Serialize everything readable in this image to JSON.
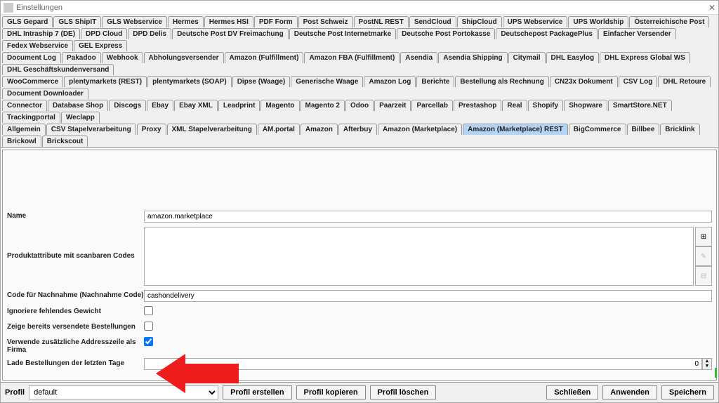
{
  "title": "Einstellungen",
  "tabs_row1": [
    "GLS Gepard",
    "GLS ShipIT",
    "GLS Webservice",
    "Hermes",
    "Hermes HSI",
    "PDF Form",
    "Post Schweiz",
    "PostNL REST",
    "SendCloud",
    "ShipCloud",
    "UPS Webservice",
    "UPS Worldship",
    "Österreichische Post"
  ],
  "tabs_row2": [
    "DHL Intraship 7 (DE)",
    "DPD Cloud",
    "DPD Delis",
    "Deutsche Post DV Freimachung",
    "Deutsche Post Internetmarke",
    "Deutsche Post Portokasse",
    "Deutschepost PackagePlus",
    "Einfacher Versender",
    "Fedex Webservice",
    "GEL Express"
  ],
  "tabs_row3": [
    "Document Log",
    "Pakadoo",
    "Webhook",
    "Abholungsversender",
    "Amazon (Fulfillment)",
    "Amazon FBA (Fulfillment)",
    "Asendia",
    "Asendia Shipping",
    "Citymail",
    "DHL Easylog",
    "DHL Express Global WS",
    "DHL Geschäftskundenversand"
  ],
  "tabs_row4": [
    "WooCommerce",
    "plentymarkets (REST)",
    "plentymarkets (SOAP)",
    "Dipse (Waage)",
    "Generische Waage",
    "Amazon Log",
    "Berichte",
    "Bestellung als Rechnung",
    "CN23x Dokument",
    "CSV Log",
    "DHL Retoure",
    "Document Downloader"
  ],
  "tabs_row5": [
    "Connector",
    "Database Shop",
    "Discogs",
    "Ebay",
    "Ebay XML",
    "Leadprint",
    "Magento",
    "Magento 2",
    "Odoo",
    "Paarzeit",
    "Parcellab",
    "Prestashop",
    "Real",
    "Shopify",
    "Shopware",
    "SmartStore.NET",
    "Trackingportal",
    "Weclapp"
  ],
  "tabs_row6": [
    "Allgemein",
    "CSV Stapelverarbeitung",
    "Proxy",
    "XML Stapelverarbeitung",
    "AM.portal",
    "Amazon",
    "Afterbuy",
    "Amazon (Marketplace)",
    "Amazon (Marketplace) REST",
    "BigCommerce",
    "Billbee",
    "Bricklink",
    "Brickowl",
    "Brickscout"
  ],
  "active_tab": "Amazon (Marketplace) REST",
  "form": {
    "name_label": "Name",
    "name_value": "amazon.marketplace",
    "attrs_label": "Produktattribute mit scanbaren Codes",
    "attrs_value": "",
    "code_label": "Code für Nachnahme (Nachnahme Code)",
    "code_value": "cashondelivery",
    "ignore_label": "Ignoriere fehlendes Gewicht",
    "ignore_value": false,
    "show_sent_label": "Zeige bereits versendete Bestellungen",
    "show_sent_value": false,
    "extra_addr_label": "Verwende zusätzliche Addresszeile als Firma",
    "extra_addr_value": true,
    "load_days_label": "Lade Bestellungen der letzten Tage",
    "load_days_value": "0"
  },
  "icons": {
    "add": "⊞",
    "edit": "✎",
    "del": "⊟"
  },
  "footer": {
    "profile_label": "Profil",
    "profile_value": "default",
    "btn_create": "Profil erstellen",
    "btn_copy": "Profil kopieren",
    "btn_delete": "Profil löschen",
    "btn_close": "Schließen",
    "btn_apply": "Anwenden",
    "btn_save": "Speichern"
  }
}
